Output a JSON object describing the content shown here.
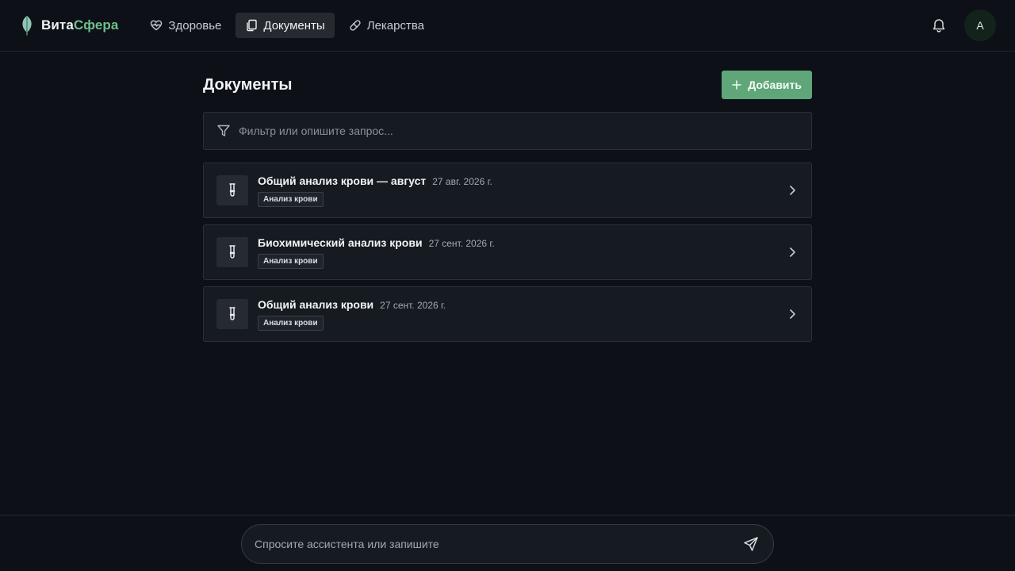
{
  "app": {
    "logo_part1": "Вита",
    "logo_part2": "Сфера"
  },
  "nav": {
    "items": [
      {
        "label": "Здоровье",
        "icon": "heart-pulse-icon",
        "active": false
      },
      {
        "label": "Документы",
        "icon": "documents-icon",
        "active": true
      },
      {
        "label": "Лекарства",
        "icon": "pill-icon",
        "active": false
      }
    ]
  },
  "user": {
    "avatar_initial": "А"
  },
  "page": {
    "title": "Документы",
    "add_button_label": "Добавить",
    "filter_placeholder": "Фильтр или опишите запрос..."
  },
  "documents": [
    {
      "title": "Общий анализ крови — август",
      "date": "27 авг. 2026 г.",
      "tag": "Анализ крови",
      "icon": "test-tube-icon"
    },
    {
      "title": "Биохимический анализ крови",
      "date": "27 сент. 2026 г.",
      "tag": "Анализ крови",
      "icon": "test-tube-icon"
    },
    {
      "title": "Общий анализ крови",
      "date": "27 сент. 2026 г.",
      "tag": "Анализ крови",
      "icon": "test-tube-icon"
    }
  ],
  "assistant": {
    "placeholder": "Спросите ассистента или запишите"
  },
  "colors": {
    "background": "#0d1117",
    "card": "#161b21",
    "accent": "#5fa679",
    "logo_accent": "#6fbf8b"
  }
}
